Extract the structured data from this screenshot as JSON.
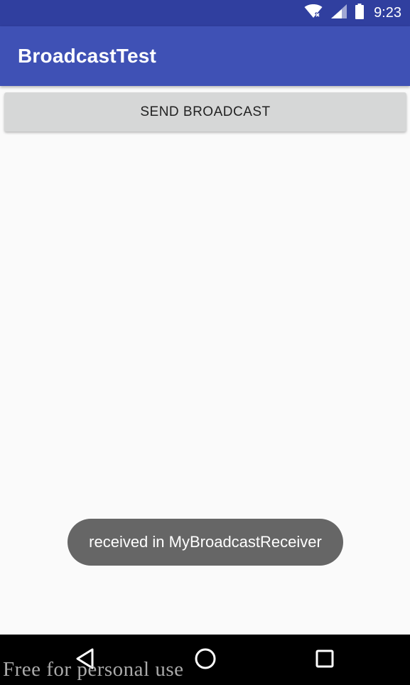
{
  "status_bar": {
    "time": "9:23",
    "icons": [
      "wifi-icon",
      "signal-icon",
      "battery-icon"
    ],
    "background": "#303f9f"
  },
  "app_bar": {
    "title": "BroadcastTest",
    "background": "#3f51b5"
  },
  "main": {
    "send_button_label": "SEND BROADCAST",
    "button_background": "#d6d7d7"
  },
  "toast": {
    "message": "received in MyBroadcastReceiver",
    "background": "#666666"
  },
  "nav_bar": {
    "icons": [
      "back-icon",
      "home-icon",
      "recents-icon"
    ],
    "background": "#000000"
  },
  "watermark": {
    "text": "Free for personal use"
  }
}
